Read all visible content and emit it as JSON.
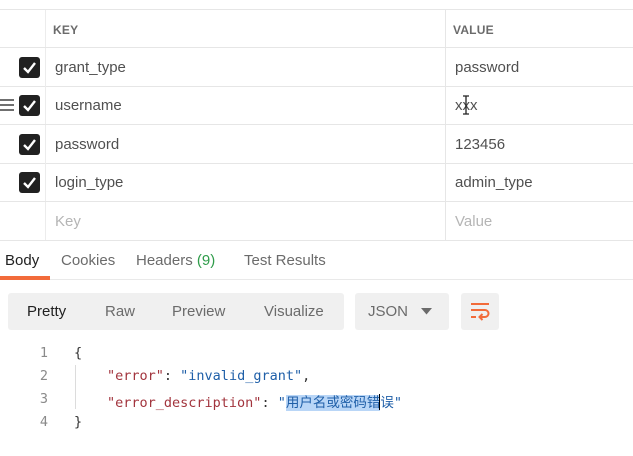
{
  "params": {
    "columns": {
      "key": "KEY",
      "value": "VALUE"
    },
    "rows": [
      {
        "key": "grant_type",
        "value": "password",
        "checked": true
      },
      {
        "key": "username",
        "value": "xxx",
        "checked": true
      },
      {
        "key": "password",
        "value": "123456",
        "checked": true
      },
      {
        "key": "login_type",
        "value": "admin_type",
        "checked": true
      }
    ],
    "new_row": {
      "key_placeholder": "Key",
      "value_placeholder": "Value"
    }
  },
  "response_tabs": {
    "body": "Body",
    "cookies": "Cookies",
    "headers": "Headers",
    "headers_count": "(9)",
    "test_results": "Test Results",
    "active": "Body",
    "accent": "#f26b3a"
  },
  "format_bar": {
    "modes": [
      "Pretty",
      "Raw",
      "Preview",
      "Visualize"
    ],
    "active": "Pretty",
    "format": "JSON",
    "wrap_icon": "wrap-lines-icon"
  },
  "response_body": {
    "line_numbers": [
      "1",
      "2",
      "3",
      "4"
    ],
    "open_brace": "{",
    "close_brace": "}",
    "error_key": "\"error\"",
    "error_value": "\"invalid_grant\"",
    "desc_key": "\"error_description\"",
    "desc_quote": "\"",
    "desc_selected": "用户名或密码错",
    "desc_rest": "误",
    "colon": ": ",
    "comma": ","
  }
}
